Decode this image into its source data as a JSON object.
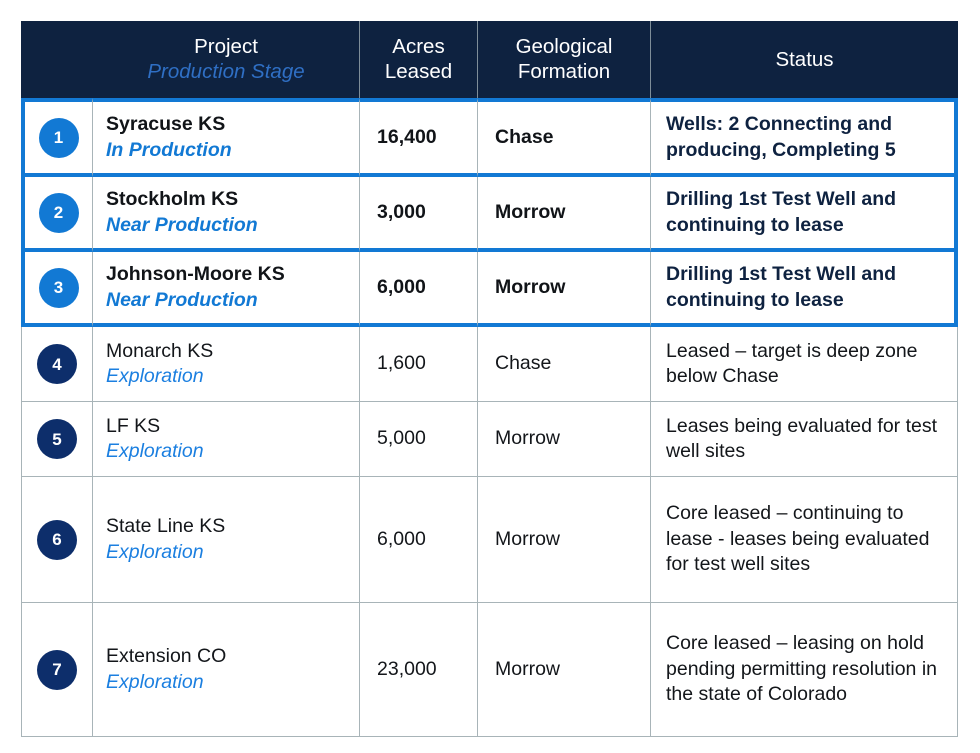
{
  "table": {
    "columns": [
      {
        "key": "num",
        "label": "",
        "sub": ""
      },
      {
        "key": "project",
        "label": "Project",
        "sub": "Production Stage"
      },
      {
        "key": "acres",
        "label": "Acres\nLeased",
        "line1": "Acres",
        "line2": "Leased"
      },
      {
        "key": "formation",
        "line1": "Geological",
        "line2": "Formation"
      },
      {
        "key": "status",
        "label": "Status"
      }
    ],
    "rows": [
      {
        "num": "1",
        "project": "Syracuse KS",
        "stage": "In Production",
        "acres": "16,400",
        "formation": "Chase",
        "status": "Wells: 2 Connecting and producing, Completing 5",
        "highlighted": true
      },
      {
        "num": "2",
        "project": "Stockholm KS",
        "stage": "Near Production",
        "acres": "3,000",
        "formation": "Morrow",
        "status": "Drilling 1st Test Well and continuing to lease",
        "highlighted": true
      },
      {
        "num": "3",
        "project": "Johnson-Moore KS",
        "stage": "Near Production",
        "acres": "6,000",
        "formation": "Morrow",
        "status": "Drilling 1st Test Well and continuing to lease",
        "highlighted": true
      },
      {
        "num": "4",
        "project": "Monarch KS",
        "stage": "Exploration",
        "acres": "1,600",
        "formation": "Chase",
        "status": "Leased – target is deep zone below Chase",
        "highlighted": false
      },
      {
        "num": "5",
        "project": "LF KS",
        "stage": "Exploration",
        "acres": "5,000",
        "formation": "Morrow",
        "status": "Leases being evaluated for test well sites",
        "highlighted": false
      },
      {
        "num": "6",
        "project": "State Line KS",
        "stage": "Exploration",
        "acres": "6,000",
        "formation": "Morrow",
        "status": "Core leased – continuing to lease - leases being evaluated for test well sites",
        "highlighted": false
      },
      {
        "num": "7",
        "project": "Extension CO",
        "stage": "Exploration",
        "acres": "23,000",
        "formation": "Morrow",
        "status": "Core leased – leasing on hold pending permitting resolution in the state of Colorado",
        "highlighted": false
      }
    ]
  },
  "colors": {
    "header_bg": "#0e2240",
    "header_sub_text": "#2f6fc4",
    "accent_blue": "#1279d4",
    "badge_navy": "#0d2e6b",
    "grid_line": "#a8b4b8",
    "body_text": "#13161a",
    "stage_text": "#1b7fe0"
  }
}
